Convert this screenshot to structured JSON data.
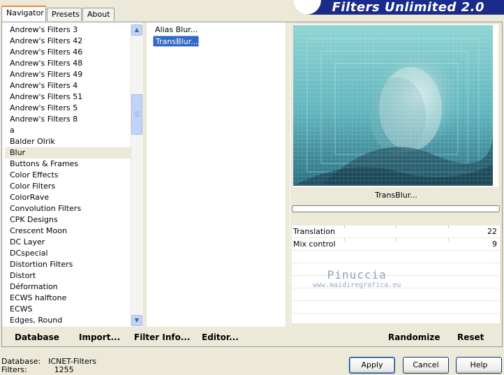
{
  "window": {
    "title": "Filters Unlimited 2.0"
  },
  "tabs": [
    {
      "label": "Navigator",
      "active": true
    },
    {
      "label": "Presets",
      "active": false
    },
    {
      "label": "About",
      "active": false
    }
  ],
  "categories": [
    "Andrew's Filters 3",
    "Andrew's Filters 42",
    "Andrew's Filters 46",
    "Andrew's Filters 48",
    "Andrew's Filters 49",
    "Andrew's Filters 4",
    "Andrew's Filters 51",
    "Andrew's Filters 5",
    "Andrew's Filters 8",
    "a",
    "Balder Olrik",
    "Blur",
    "Buttons & Frames",
    "Color Effects",
    "Color Filters",
    "ColorRave",
    "Convolution Filters",
    "CPK Designs",
    "Crescent Moon",
    "DC Layer",
    "DCspecial",
    "Distortion Filters",
    "Distort",
    "Déformation",
    "ECWS halftone",
    "ECWS",
    "Edges, Round"
  ],
  "selected_category": "Blur",
  "filters": [
    "Alias Blur...",
    "TransBlur..."
  ],
  "selected_filter": "TransBlur...",
  "preview": {
    "filter_name": "TransBlur..."
  },
  "params": [
    {
      "label": "Translation",
      "value": "22"
    },
    {
      "label": "Mix control",
      "value": "9"
    }
  ],
  "toolbar": {
    "database": "Database",
    "import": "Import...",
    "filter_info": "Filter Info...",
    "editor": "Editor...",
    "randomize": "Randomize",
    "reset": "Reset"
  },
  "watermark": {
    "line1": "Pinuccia",
    "line2": "www.maidiregrafica.eu"
  },
  "status": {
    "database_label": "Database:",
    "database_value": "ICNET-Filters",
    "filters_label": "Filters:",
    "filters_value": "1255"
  },
  "buttons": {
    "apply": "Apply",
    "cancel": "Cancel",
    "help": "Help"
  },
  "colors": {
    "selection": "#316ac5",
    "banner": "#1a2b8a",
    "tab_accent": "#e68b2c"
  }
}
